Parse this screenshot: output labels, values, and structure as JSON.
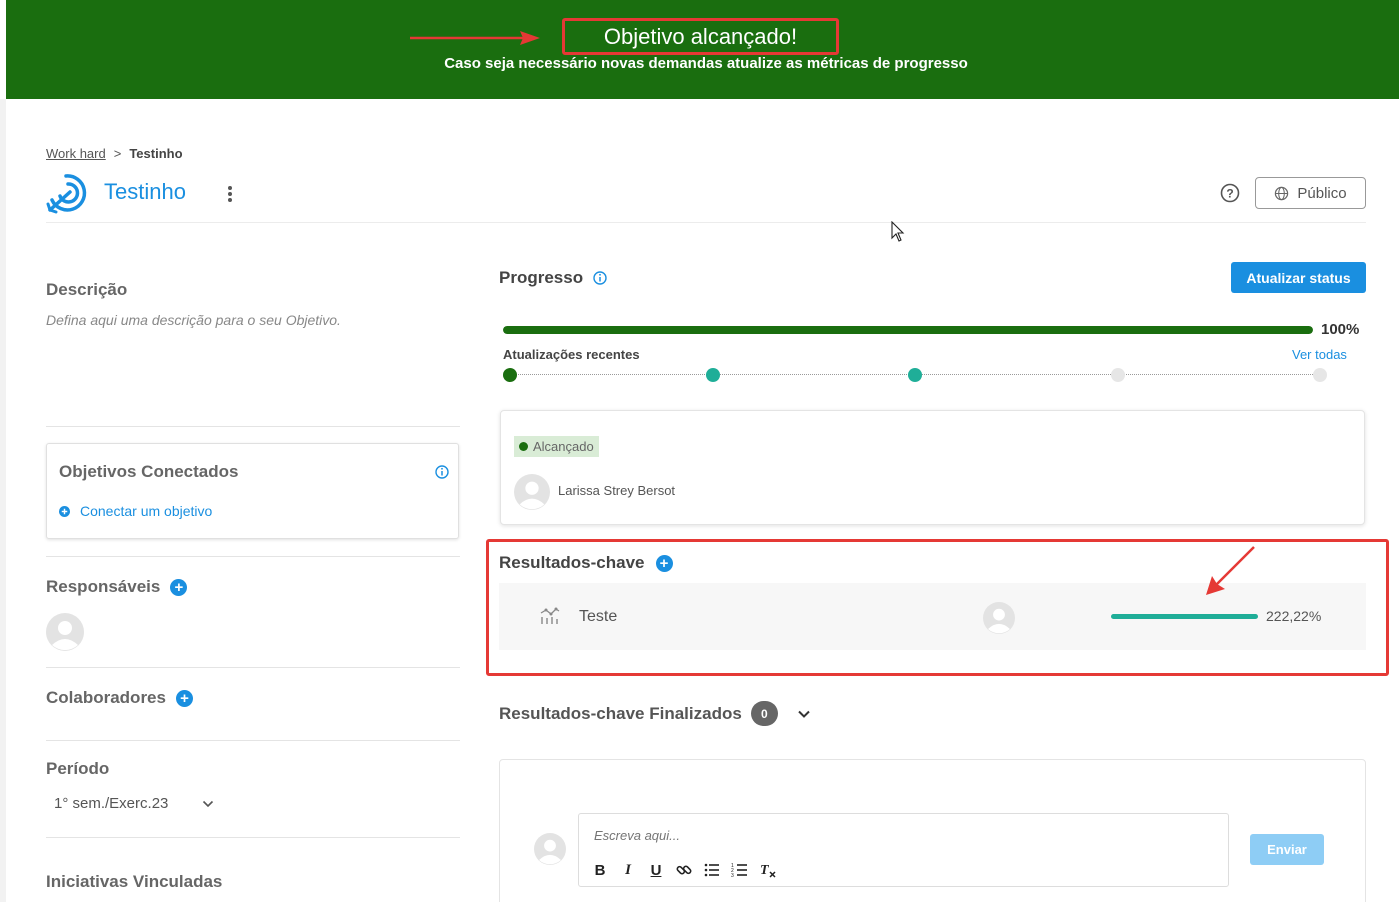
{
  "banner": {
    "title": "Objetivo alcançado!",
    "subtitle": "Caso seja necessário novas demandas atualize as métricas de progresso",
    "color": "#1a6e0f"
  },
  "breadcrumb": {
    "parent": "Work hard",
    "separator": ">",
    "current": "Testinho"
  },
  "objective": {
    "title": "Testinho",
    "visibility_label": "Público"
  },
  "left": {
    "description_label": "Descrição",
    "description_placeholder": "Defina aqui uma descrição para o seu Objetivo.",
    "connected_title": "Objetivos Conectados",
    "connect_link": "Conectar um objetivo",
    "responsible_label": "Responsáveis",
    "collaborators_label": "Colaboradores",
    "period_label": "Período",
    "period_value": "1° sem./Exerc.23",
    "initiatives_label": "Iniciativas Vinculadas"
  },
  "progress": {
    "title": "Progresso",
    "update_button": "Atualizar status",
    "percent": 100,
    "percent_label": "100%",
    "recent_label": "Atualizações recentes",
    "see_all": "Ver todas",
    "timeline_colors": [
      "#1a6e0f",
      "#1fae98",
      "#1fae98",
      "#e6e6e6",
      "#e6e6e6"
    ]
  },
  "status_card": {
    "badge": "Alcançado",
    "user": "Larissa Strey Bersot"
  },
  "key_results": {
    "title": "Resultados-chave",
    "items": [
      {
        "name": "Teste",
        "percent_label": "222,22%",
        "progress": 1.0
      }
    ]
  },
  "finished_kr": {
    "title": "Resultados-chave Finalizados",
    "count": "0"
  },
  "comment": {
    "placeholder": "Escreva aqui...",
    "send_label": "Enviar"
  },
  "colors": {
    "accent": "#1a8fe0",
    "success": "#1a6e0f",
    "kr_bar": "#1fae98",
    "highlight": "#e53935"
  }
}
